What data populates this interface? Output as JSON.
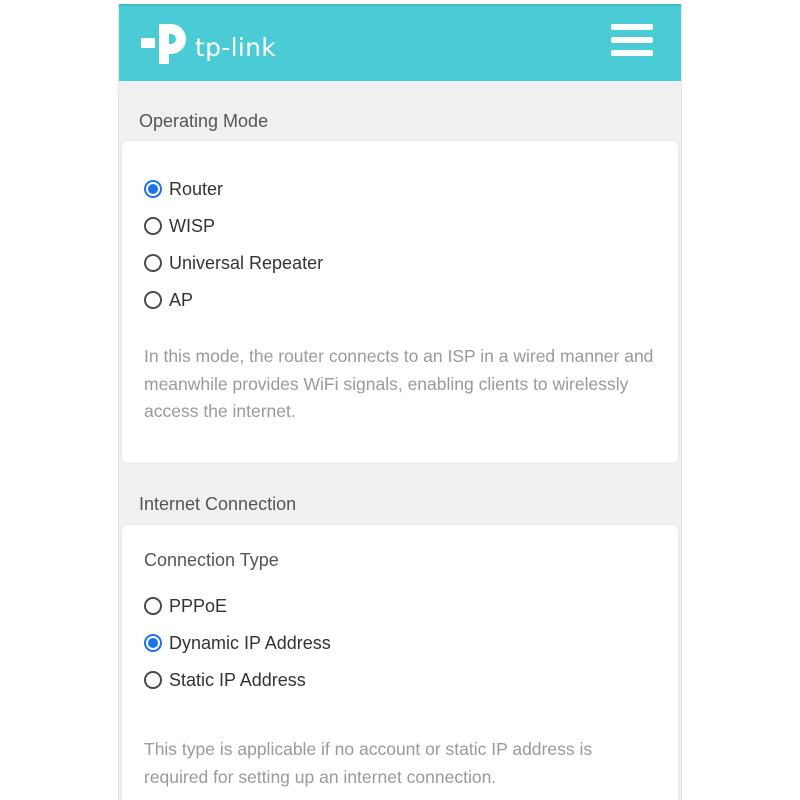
{
  "header": {
    "brand": "tp-link",
    "menu_icon": "hamburger-menu-icon",
    "color": "#4acbd6"
  },
  "operating_mode": {
    "title": "Operating Mode",
    "options": [
      {
        "label": "Router",
        "checked": true
      },
      {
        "label": "WISP",
        "checked": false
      },
      {
        "label": "Universal Repeater",
        "checked": false
      },
      {
        "label": "AP",
        "checked": false
      }
    ],
    "description": "In this mode, the router connects to an ISP in a wired manner and meanwhile provides WiFi signals, enabling clients to wirelessly access the internet."
  },
  "internet_connection": {
    "title": "Internet Connection",
    "connection_type_label": "Connection Type",
    "options": [
      {
        "label": "PPPoE",
        "checked": false
      },
      {
        "label": "Dynamic IP Address",
        "checked": true
      },
      {
        "label": "Static IP Address",
        "checked": false
      }
    ],
    "description": "This type is applicable if no account or static IP address is required for setting up an internet connection."
  },
  "colors": {
    "accent": "#1a73e8",
    "header": "#4acbd6"
  }
}
